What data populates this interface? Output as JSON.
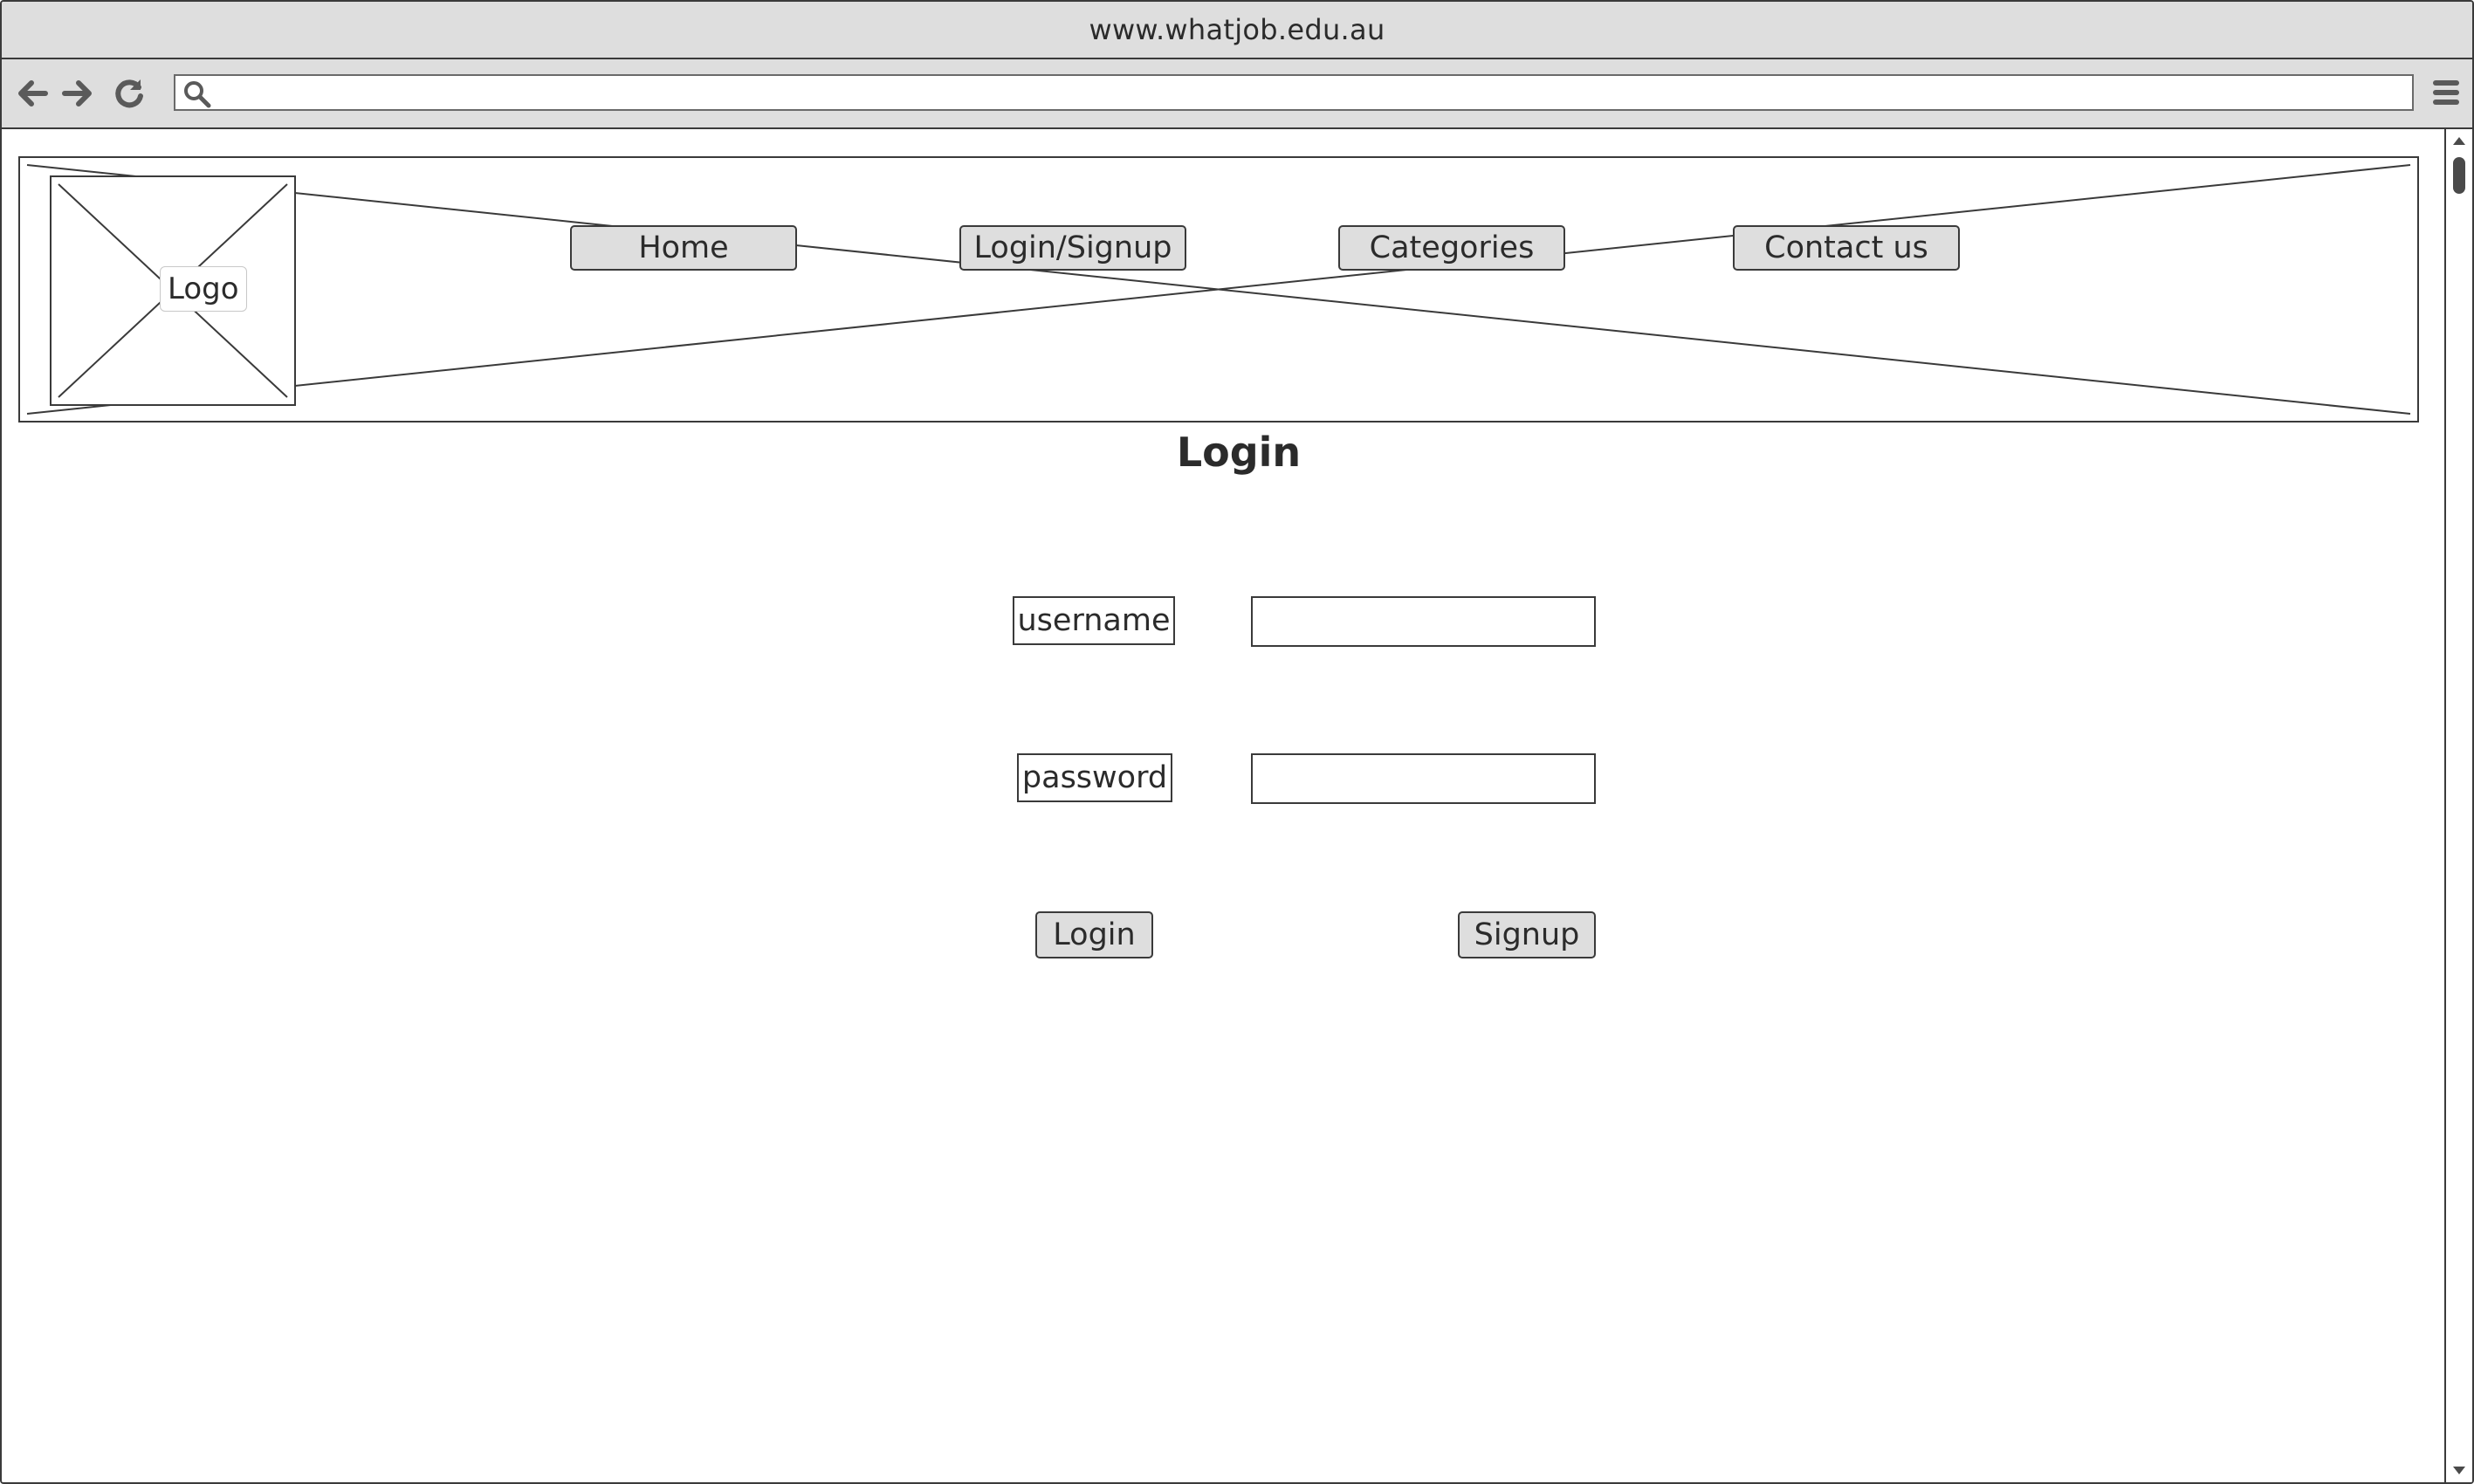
{
  "browser": {
    "url": "www.whatjob.edu.au",
    "search_value": "",
    "icons": [
      "back-arrow-icon",
      "forward-arrow-icon",
      "reload-icon",
      "search-icon",
      "hamburger-menu-icon"
    ]
  },
  "header": {
    "logo_label": "Logo",
    "nav": {
      "home": "Home",
      "login_signup": "Login/Signup",
      "categories": "Categories",
      "contact": "Contact us"
    }
  },
  "main": {
    "heading": "Login",
    "username_label": "username",
    "username_value": "",
    "password_label": "password",
    "password_value": "",
    "login_button": "Login",
    "signup_button": "Signup"
  },
  "colors": {
    "chrome": "#dedede",
    "border": "#3a3a3a",
    "background": "#ffffff",
    "text": "#2b2b2b"
  }
}
